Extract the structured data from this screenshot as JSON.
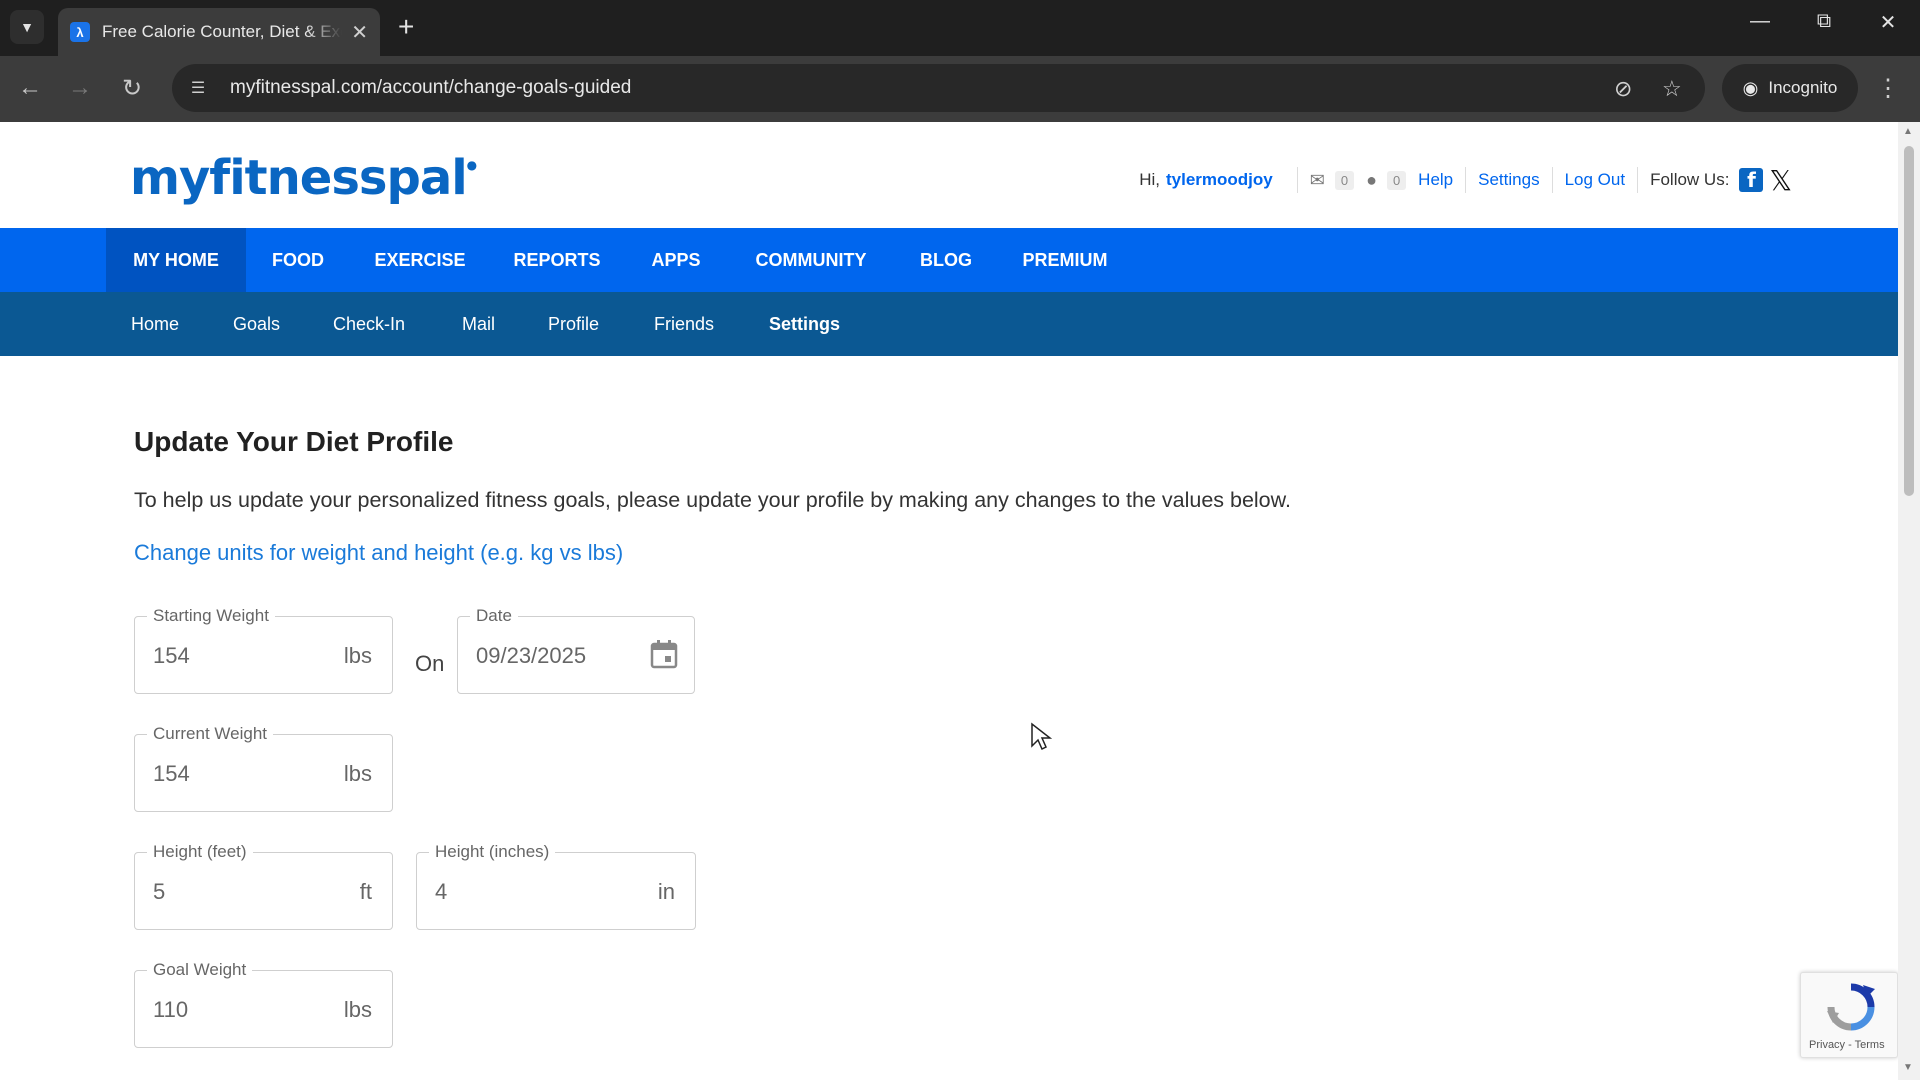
{
  "browser": {
    "tab_title": "Free Calorie Counter, Diet & Exercise Journal",
    "new_tab_label": "+",
    "url": "myfitnesspal.com/account/change-goals-guided",
    "incognito_label": "Incognito"
  },
  "site": {
    "logo": "myfitnesspal",
    "userbar": {
      "greeting": "Hi,",
      "username": "tylermoodjoy",
      "mail_count": "0",
      "friend_requests_count": "0",
      "help": "Help",
      "settings": "Settings",
      "logout": "Log Out",
      "follow_us": "Follow Us:"
    },
    "main_nav": [
      "MY HOME",
      "FOOD",
      "EXERCISE",
      "REPORTS",
      "APPS",
      "COMMUNITY",
      "BLOG",
      "PREMIUM"
    ],
    "main_nav_active": "MY HOME",
    "sub_nav": [
      "Home",
      "Goals",
      "Check-In",
      "Mail",
      "Profile",
      "Friends",
      "Settings"
    ],
    "sub_nav_active": "Settings"
  },
  "form": {
    "title": "Update Your Diet Profile",
    "intro": "To help us update your personalized fitness goals, please update your profile by making any changes to the values below.",
    "units_link": "Change units for weight and height (e.g. kg vs lbs)",
    "starting_weight": {
      "label": "Starting Weight",
      "value": "154",
      "unit": "lbs"
    },
    "on_text": "On",
    "date": {
      "label": "Date",
      "value": "09/23/2025"
    },
    "current_weight": {
      "label": "Current Weight",
      "value": "154",
      "unit": "lbs"
    },
    "height_feet": {
      "label": "Height (feet)",
      "value": "5",
      "unit": "ft"
    },
    "height_inches": {
      "label": "Height (inches)",
      "value": "4",
      "unit": "in"
    },
    "goal_weight": {
      "label": "Goal Weight",
      "value": "110",
      "unit": "lbs"
    }
  },
  "recaptcha": {
    "footer": "Privacy - Terms"
  },
  "colors": {
    "brand_blue": "#0066ee",
    "subnav_blue": "#0b5893",
    "link_blue": "#1a7ad9"
  }
}
